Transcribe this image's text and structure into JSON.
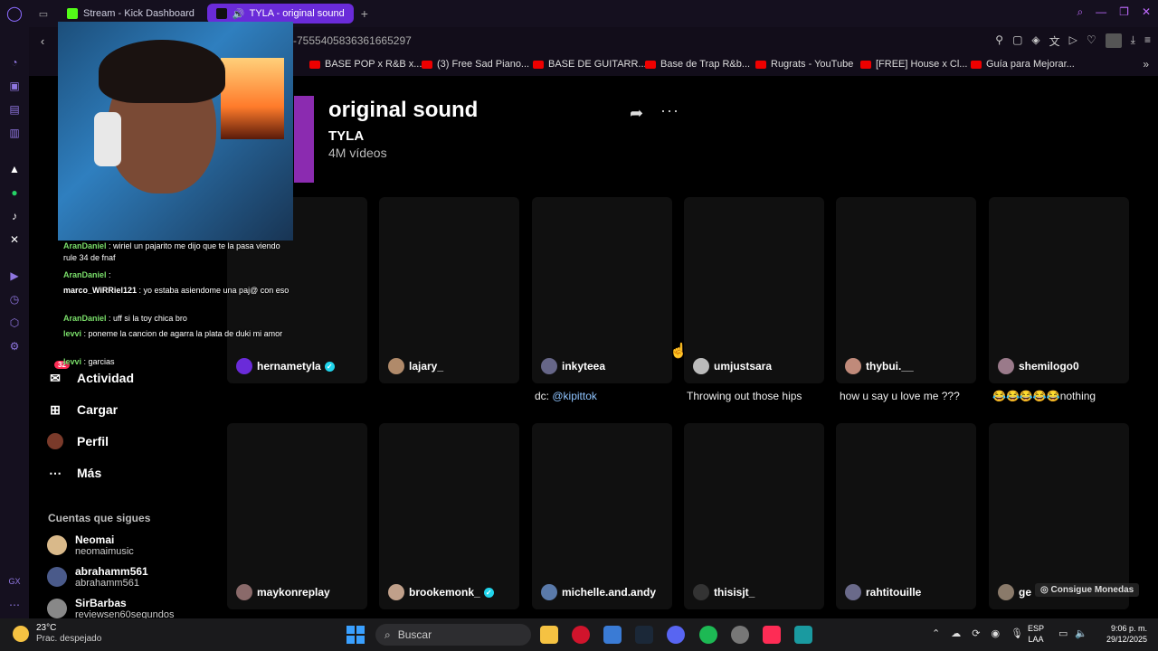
{
  "browser": {
    "tabs": [
      {
        "label": "Stream - Kick Dashboard",
        "active": false
      },
      {
        "label": "TYLA - original sound",
        "active": true
      }
    ],
    "url_fragment": "-7555405836361665297",
    "bookmarks": [
      "BASE POP x R&B x...",
      "(3) Free Sad Piano...",
      "BASE DE GUITARR...",
      "Base de Trap R&b...",
      "Rugrats - YouTube",
      "[FREE] House x Cl...",
      "Guía para Mejorar..."
    ]
  },
  "sidebar": {
    "nav": [
      {
        "label": "Actividad",
        "icon": "activity-icon",
        "badge": "32"
      },
      {
        "label": "Cargar",
        "icon": "upload-icon"
      },
      {
        "label": "Perfil",
        "icon": "profile-avatar-icon"
      },
      {
        "label": "Más",
        "icon": "more-dots-icon"
      }
    ],
    "following_title": "Cuentas que sigues",
    "following": [
      {
        "name": "Neomai",
        "handle": "neomaimusic"
      },
      {
        "name": "abrahamm561",
        "handle": "abrahamm561"
      },
      {
        "name": "SirBarbas",
        "handle": "reviewsen60segundos"
      }
    ]
  },
  "sound": {
    "title": "original sound",
    "artist": "TYLA",
    "video_count": "4M vídeos"
  },
  "videos_row1": [
    {
      "user": "hernametyla",
      "verified": true
    },
    {
      "user": "lajary_",
      "verified": false
    },
    {
      "user": "inkyteea",
      "verified": false
    },
    {
      "user": "umjustsara",
      "verified": false
    },
    {
      "user": "thybui.__",
      "verified": false
    },
    {
      "user": "shemilogo0",
      "verified": false
    }
  ],
  "captions_row1": [
    {
      "prefix": "dc: ",
      "mention": "@kipittok"
    },
    {
      "prefix": "Throwing out those hips",
      "mention": ""
    },
    {
      "prefix": "how u say u love me ???",
      "mention": ""
    },
    {
      "prefix": "😂😂😂😂😂nothing",
      "mention": ""
    }
  ],
  "videos_row2": [
    {
      "user": "maykonreplay",
      "verified": false
    },
    {
      "user": "brookemonk_",
      "verified": true
    },
    {
      "user": "michelle.and.andy",
      "verified": false
    },
    {
      "user": "thisisjt_",
      "verified": false
    },
    {
      "user": "rahtitouille",
      "verified": false
    },
    {
      "user": "ge",
      "verified": false
    }
  ],
  "coins_label": "Consigue Monedas",
  "chat": [
    {
      "user": "AranDaniel",
      "text": ": wiriel un pajarito me dijo que te la pasa viendo rule 34 de fnaf"
    },
    {
      "user": "AranDaniel",
      "text": ":"
    },
    {
      "user": "marco_WiRRiel121",
      "text": ": yo estaba asiendome una paj@ con eso"
    },
    {
      "user": "AranDaniel",
      "text": ": uff si la toy chica bro"
    },
    {
      "user": "levvi",
      "text": ": poneme la cancion de agarra la plata de duki mi amor"
    },
    {
      "user": "levvi",
      "text": ": garcias"
    }
  ],
  "taskbar": {
    "temperature": "23°C",
    "condition": "Prac. despejado",
    "search_placeholder": "Buscar",
    "lang_top": "ESP",
    "lang_bottom": "LAA",
    "time": "9:06 p. m.",
    "date": "29/12/2025"
  },
  "colors": {
    "active_tab": "#6a2bd9",
    "verified": "#20d5ec",
    "mention": "#8fc4ff",
    "badge": "#fe2c55",
    "chat_user": "#7adf6a"
  }
}
